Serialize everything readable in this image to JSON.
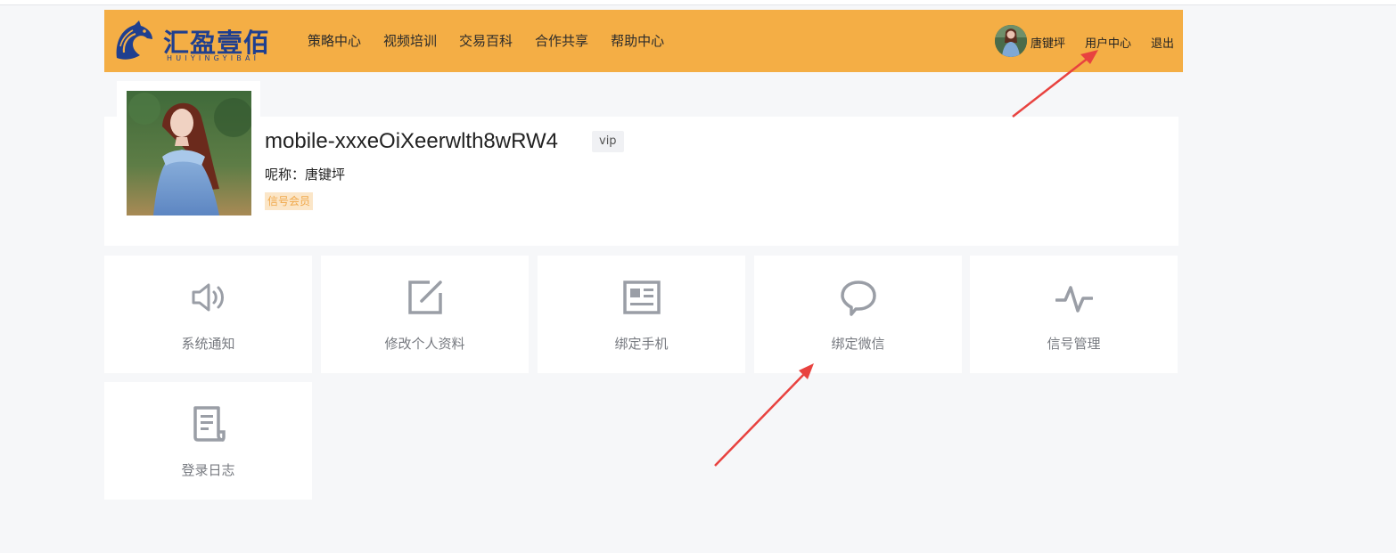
{
  "header": {
    "logo_cn": "汇盈壹佰",
    "logo_en": "HUIYINGYIBAI",
    "nav": [
      "策略中心",
      "视频培训",
      "交易百科",
      "合作共享",
      "帮助中心"
    ],
    "username": "唐键坪",
    "user_center": "用户中心",
    "logout": "退出",
    "bg_color": "#f4ae45"
  },
  "profile": {
    "account": "mobile-xxxeOiXeerwlth8wRW4",
    "vip": "vip",
    "nickname_label": "呢称：",
    "nickname": "唐键坪",
    "member_badge": "信号会员"
  },
  "tiles": [
    {
      "label": "系统通知",
      "icon": "speaker-icon"
    },
    {
      "label": "修改个人资料",
      "icon": "edit-icon"
    },
    {
      "label": "绑定手机",
      "icon": "newspaper-icon"
    },
    {
      "label": "绑定微信",
      "icon": "chat-bubble-icon"
    },
    {
      "label": "信号管理",
      "icon": "pulse-icon"
    },
    {
      "label": "登录日志",
      "icon": "log-document-icon"
    }
  ],
  "annotations": {
    "arrow_color": "#e8423f"
  }
}
